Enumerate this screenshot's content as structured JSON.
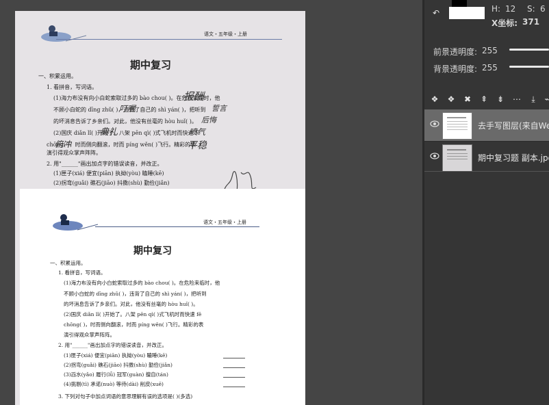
{
  "panel": {
    "h_label": "H:",
    "h_value": "12",
    "s_label": "S:",
    "s_value": "6",
    "x_coord_label": "X坐标:",
    "x_coord_value": "371",
    "fg_opacity_label": "前景透明度:",
    "fg_opacity_value": "255",
    "bg_opacity_label": "背景透明度:",
    "bg_opacity_value": "255"
  },
  "layers": [
    {
      "name": "去手写图层(来自We",
      "selected": true
    },
    {
      "name": "期中复习题 副本.jpg",
      "selected": false
    }
  ],
  "toolbar_icons": [
    "layer-add-icon",
    "layer-copy-icon",
    "layer-delete-icon",
    "layer-up-icon",
    "layer-down-icon",
    "more-icon",
    "download-icon",
    "link-icon"
  ],
  "doc": {
    "header": "语文・五年级・上册",
    "title": "期中复习",
    "section": "一、积累运用。",
    "q1": "1. 看拼音，写词语。",
    "q1_1a": "(1)海力布没有向小白蛇索取过多的 bào chou(          )。在危险来临时，他",
    "q1_1b": "不顾小白蛇的 dīng zhǔ(          )，违背了自己的 shì yán(          )，把听到",
    "q1_1c": "的坏消息告诉了乡亲们。对此，他没有丝毫的 hòu huǐ(          )。",
    "q1_2a": "(2)国庆 diǎn lǐ(          )开始了。八架 pēn qì(          )式飞机时而快速 fē",
    "q1_2b": "chōng(          )，时而侧向翻滚，时而 píng wěn(          )飞行。精彩的表",
    "q1_2c": "演引得观众掌声阵阵。",
    "q2": "2. 用\"______\"画出加点字的错误读音，并改正。",
    "q2_rows": [
      "(1)匣子(xiá)      便宜(piān)      执拗(yòu)      瞌睡(kē)",
      "(2)拐弯(guǎi)     礁石(jiāo)      抖擞(shù)      勤俭(jiǎn)",
      "(3)舀水(yǎo)      履行(lǚ)        冠军(guàn)     擅自(tán)",
      "(4)挑剔(tì)       承诺(nuò)       等待(dài)      削皮(xuē)"
    ],
    "q3": "3. 下列对句子中加点词语的意思理解有误的选项是(      )(多选)",
    "handwriting": {
      "bao_chou": "报酬",
      "ding_zhu": "叮嘱",
      "shi_yan": "誓言",
      "hou_hui": "后悔",
      "dian_li": "典礼",
      "pen_qi": "喷气",
      "ping_wen": "平稳",
      "chong": "俯冲"
    }
  }
}
